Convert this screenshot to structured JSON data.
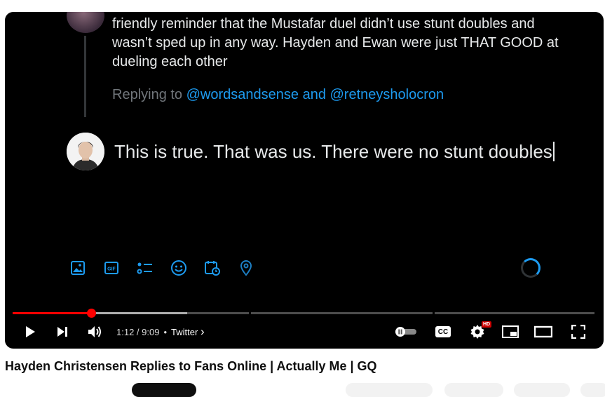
{
  "tweet": {
    "text": "friendly reminder that the Mustafar duel didn’t use stunt doubles and wasn’t sped up in any way. Hayden and Ewan were just THAT GOOD at dueling each other",
    "replying_prefix": "Replying to",
    "replying_handles": "@wordsandsense and @retneysholocron"
  },
  "reply": {
    "text": "This is true. That was us. There were no stunt doubles"
  },
  "composer_icons": [
    "image-icon",
    "gif-icon",
    "poll-icon",
    "emoji-icon",
    "schedule-icon",
    "location-icon"
  ],
  "player": {
    "time": "1:12 / 9:09",
    "separator": "•",
    "chapter": "Twitter",
    "chapter_chevron": "›",
    "progress_played": 0.135,
    "progress_loaded": 0.3,
    "hd_badge": "HD",
    "cc_label": "CC",
    "accent": "#ff0000",
    "link_color": "#1d9bf0"
  },
  "video": {
    "title": "Hayden Christensen Replies to Fans Online | Actually Me | GQ"
  }
}
